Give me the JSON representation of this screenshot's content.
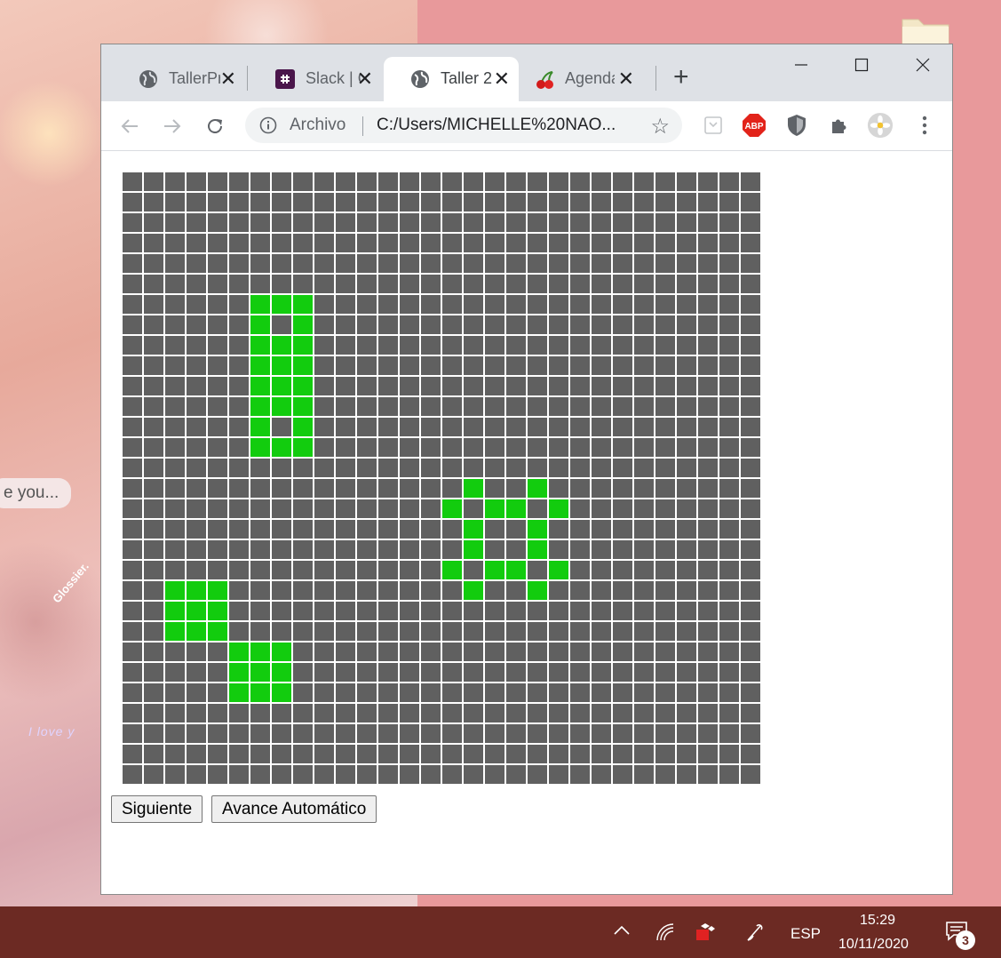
{
  "desktop": {
    "speech_text": "e you...",
    "glossier_text": "Glossier.",
    "love_text": "I love y"
  },
  "browser": {
    "tabs": [
      {
        "title": "TallerPr",
        "active": false
      },
      {
        "title": "Slack | C",
        "active": false
      },
      {
        "title": "Taller 2",
        "active": true
      },
      {
        "title": "Agenda",
        "active": false
      }
    ],
    "new_tab_label": "+",
    "close_glyph": "✕",
    "address": {
      "scheme_label": "Archivo",
      "url": "C:/Users/MICHELLE%20NAO..."
    },
    "extensions": [
      "page-icon",
      "abp-icon",
      "shield-icon",
      "puzzle-icon",
      "avatar"
    ],
    "abp_label": "ABP"
  },
  "page": {
    "grid": {
      "columns": 30,
      "rows": 30,
      "alive_color": "#12cc0e",
      "dead_color": "#606060",
      "alive_cells": [
        [
          6,
          6
        ],
        [
          6,
          7
        ],
        [
          6,
          8
        ],
        [
          7,
          6
        ],
        [
          7,
          8
        ],
        [
          8,
          6
        ],
        [
          8,
          7
        ],
        [
          8,
          8
        ],
        [
          9,
          6
        ],
        [
          9,
          7
        ],
        [
          9,
          8
        ],
        [
          10,
          6
        ],
        [
          10,
          7
        ],
        [
          10,
          8
        ],
        [
          11,
          6
        ],
        [
          11,
          7
        ],
        [
          11,
          8
        ],
        [
          12,
          6
        ],
        [
          12,
          8
        ],
        [
          13,
          6
        ],
        [
          13,
          7
        ],
        [
          13,
          8
        ],
        [
          15,
          16
        ],
        [
          15,
          19
        ],
        [
          16,
          15
        ],
        [
          16,
          17
        ],
        [
          16,
          18
        ],
        [
          16,
          20
        ],
        [
          17,
          16
        ],
        [
          17,
          19
        ],
        [
          18,
          16
        ],
        [
          18,
          19
        ],
        [
          19,
          15
        ],
        [
          19,
          17
        ],
        [
          19,
          18
        ],
        [
          19,
          20
        ],
        [
          20,
          16
        ],
        [
          20,
          19
        ],
        [
          20,
          2
        ],
        [
          20,
          3
        ],
        [
          20,
          4
        ],
        [
          21,
          2
        ],
        [
          21,
          3
        ],
        [
          21,
          4
        ],
        [
          22,
          2
        ],
        [
          22,
          3
        ],
        [
          22,
          4
        ],
        [
          23,
          5
        ],
        [
          23,
          6
        ],
        [
          23,
          7
        ],
        [
          24,
          5
        ],
        [
          24,
          6
        ],
        [
          24,
          7
        ],
        [
          25,
          5
        ],
        [
          25,
          6
        ],
        [
          25,
          7
        ]
      ]
    },
    "buttons": {
      "next_label": "Siguiente",
      "auto_label": "Avance Automático"
    }
  },
  "taskbar": {
    "language": "ESP",
    "time": "15:29",
    "date": "10/11/2020",
    "notification_count": "3"
  }
}
